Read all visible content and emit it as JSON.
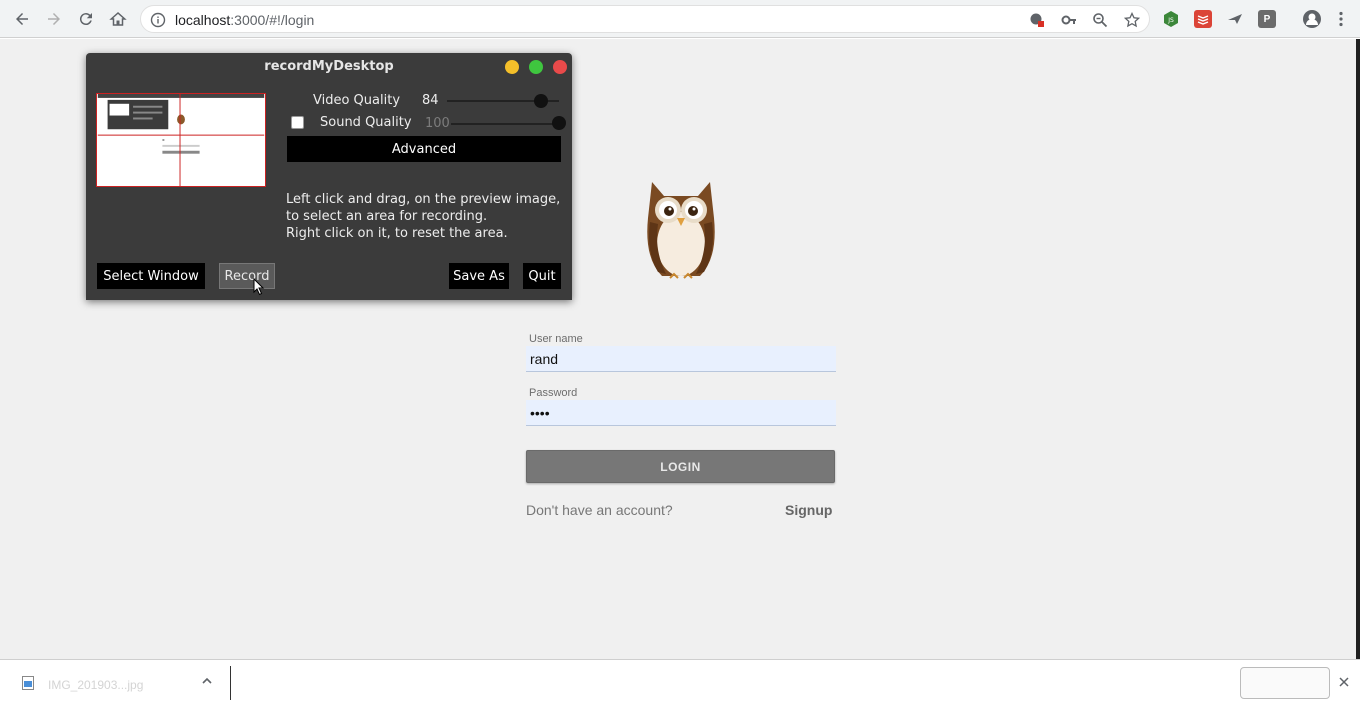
{
  "browser": {
    "url_host": "localhost",
    "url_path": ":3000/#!/login",
    "ext_p_label": "P"
  },
  "login": {
    "username_label": "User name",
    "username_value": "rand",
    "password_label": "Password",
    "password_value": "••••",
    "login_button": "LOGIN",
    "no_account_text": "Don't have an account?",
    "signup_link": "Signup"
  },
  "recorder": {
    "title": "recordMyDesktop",
    "video_quality_label": "Video Quality",
    "video_quality_value": "84",
    "video_quality_fraction": 0.84,
    "sound_quality_label": "Sound Quality",
    "sound_quality_value": "100",
    "sound_quality_fraction": 1.0,
    "sound_checked": false,
    "advanced_button": "Advanced",
    "help_line1": "Left click and drag, on the preview image,",
    "help_line2": "to select an area for recording.",
    "help_line3": "Right click on it, to reset the area.",
    "select_window_button": "Select Window",
    "record_button": "Record",
    "save_as_button": "Save As",
    "quit_button": "Quit",
    "window_button_colors": [
      "#f4bf2a",
      "#3fc63f",
      "#e94a4a"
    ]
  },
  "download_shelf": {
    "file_name": "IMG_201903...jpg"
  },
  "colors": {
    "page_bg": "#f0f0f0",
    "login_button": "#777777",
    "recorder_bg": "#3b3b3b",
    "autofill_bg": "#e8f0fe"
  }
}
